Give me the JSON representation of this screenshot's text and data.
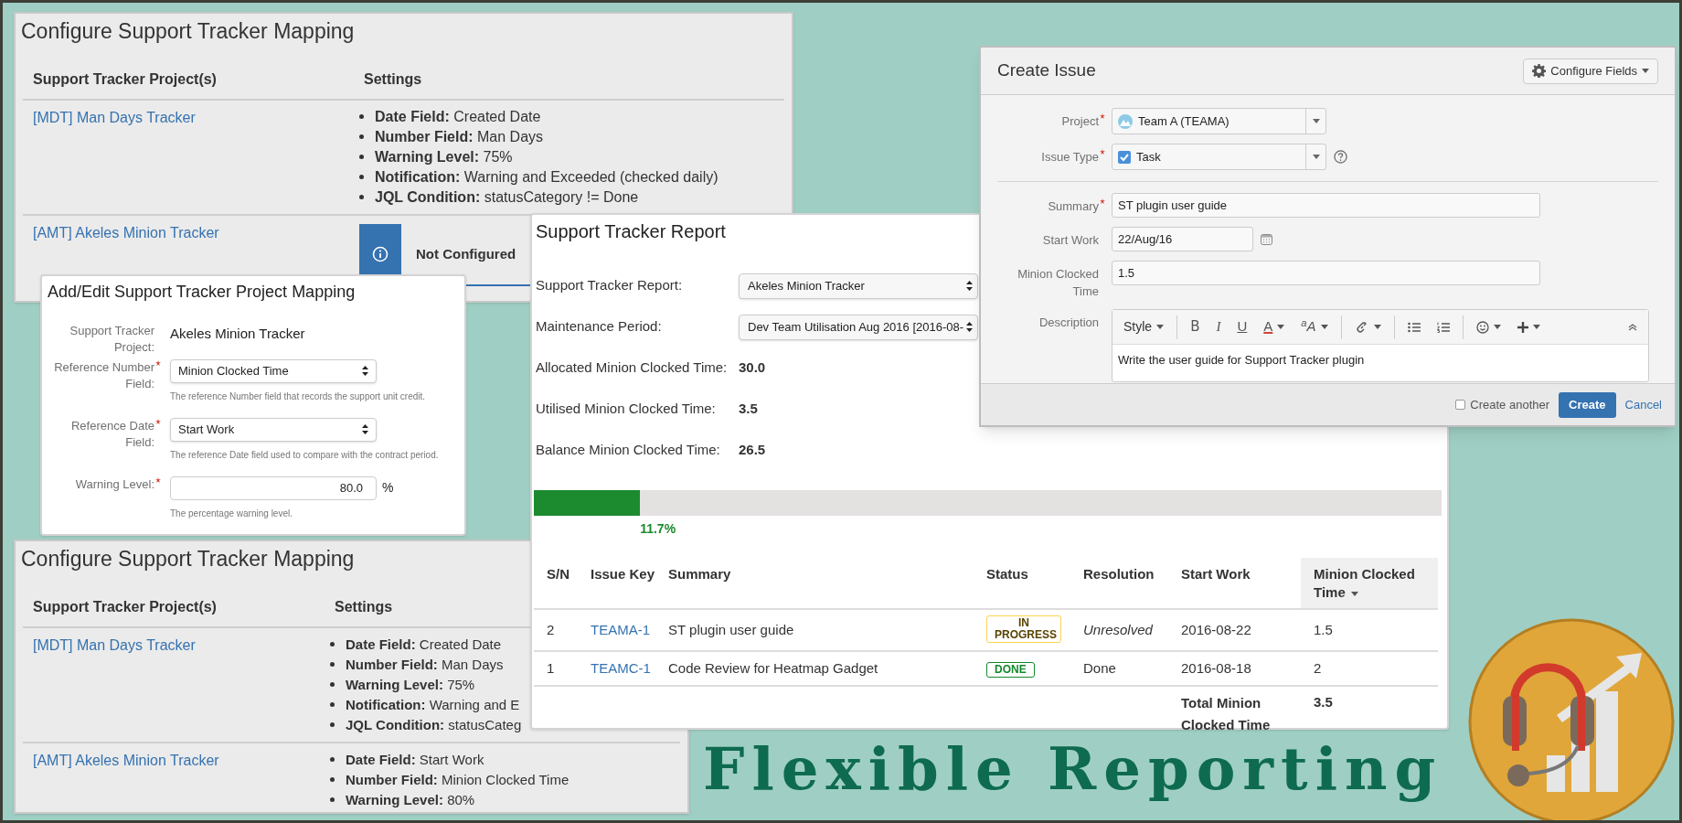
{
  "mapping_top": {
    "title": "Configure Support Tracker Mapping",
    "columns": [
      "Support Tracker Project(s)",
      "Settings"
    ],
    "rows": [
      {
        "project": "[MDT] Man Days Tracker",
        "settings": [
          {
            "label": "Date Field:",
            "value": "Created Date"
          },
          {
            "label": "Number Field:",
            "value": "Man Days"
          },
          {
            "label": "Warning Level:",
            "value": "75%"
          },
          {
            "label": "Notification:",
            "value": "Warning and Exceeded (checked daily)"
          },
          {
            "label": "JQL Condition:",
            "value": "statusCategory != Done"
          }
        ]
      },
      {
        "project": "[AMT] Akeles Minion Tracker",
        "notice": "Not Configured"
      }
    ]
  },
  "create_issue": {
    "title": "Create Issue",
    "configure_button": "Configure Fields",
    "fields": [
      {
        "kind": "project",
        "label": "Project",
        "required": true,
        "value": "Team A (TEAMA)"
      },
      {
        "kind": "issue-type",
        "label": "Issue Type",
        "required": true,
        "value": "Task"
      },
      {
        "kind": "text",
        "label": "Summary",
        "required": true,
        "value": "ST plugin user guide"
      },
      {
        "kind": "date",
        "label": "Start Work",
        "required": false,
        "value": "22/Aug/16"
      },
      {
        "kind": "text",
        "label": "Minion Clocked Time",
        "required": false,
        "value": "1.5"
      },
      {
        "kind": "editor",
        "label": "Description",
        "required": false,
        "value": "Write the user guide for Support Tracker plugin"
      }
    ],
    "toolbar": [
      {
        "kind": "style",
        "label": "Style"
      },
      {
        "kind": "separator"
      },
      {
        "kind": "bold",
        "label": "B"
      },
      {
        "kind": "italic",
        "label": "I"
      },
      {
        "kind": "underline",
        "label": "U"
      },
      {
        "kind": "color",
        "label": "A"
      },
      {
        "kind": "size",
        "label": "$^{a}$A"
      },
      {
        "kind": "separator"
      },
      {
        "kind": "link"
      },
      {
        "kind": "separator"
      },
      {
        "kind": "bullet-list"
      },
      {
        "kind": "number-list"
      },
      {
        "kind": "separator"
      },
      {
        "kind": "emoticon"
      },
      {
        "kind": "insert"
      },
      {
        "kind": "collapse"
      }
    ],
    "create_another": {
      "label": "Create another",
      "checked": false
    },
    "create_button": "Create",
    "cancel_link": "Cancel"
  },
  "mapping_dialog": {
    "title": "Add/Edit Support Tracker Project Mapping",
    "fields": [
      {
        "kind": "text",
        "label": "Support Tracker Project:",
        "required": false,
        "value": "Akeles Minion Tracker"
      },
      {
        "kind": "select",
        "label": "Reference Number Field:",
        "required": true,
        "value": "Minion Clocked Time",
        "help": "The reference Number field that records the support unit credit."
      },
      {
        "kind": "select",
        "label": "Reference Date Field:",
        "required": true,
        "value": "Start Work",
        "help": "The reference Date field used to compare with the contract period."
      },
      {
        "kind": "number",
        "label": "Warning Level:",
        "required": true,
        "value": "80.0",
        "unit": "%",
        "help": "The percentage warning level."
      }
    ]
  },
  "report": {
    "title": "Support Tracker Report",
    "filters": [
      {
        "label": "Support Tracker Report:",
        "value": "Akeles Minion Tracker"
      },
      {
        "label": "Maintenance Period:",
        "value": "Dev Team Utilisation Aug 2016 [2016-08-"
      }
    ],
    "stats": [
      {
        "label": "Allocated Minion Clocked Time:",
        "value": "30.0"
      },
      {
        "label": "Utilised Minion Clocked Time:",
        "value": "3.5"
      },
      {
        "label": "Balance Minion Clocked Time:",
        "value": "26.5"
      }
    ],
    "progress": {
      "level": 0.117,
      "reading": "11.7%"
    },
    "table": {
      "columns": [
        {
          "label": "S/N",
          "sorted": false
        },
        {
          "label": "Issue Key",
          "sorted": false
        },
        {
          "label": "Summary",
          "sorted": false
        },
        {
          "label": "Status",
          "sorted": false
        },
        {
          "label": "Resolution",
          "sorted": false
        },
        {
          "label": "Start Work",
          "sorted": false
        },
        {
          "label": "Minion Clocked Time",
          "sorted": true
        }
      ],
      "rows": [
        {
          "sn": "2",
          "key": "TEAMA-1",
          "summary": "ST plugin user guide",
          "status": {
            "text": "IN PROGRESS",
            "kind": "in-progress"
          },
          "resolution": "Unresolved",
          "resolved": false,
          "start": "2016-08-22",
          "time": "1.5"
        },
        {
          "sn": "1",
          "key": "TEAMC-1",
          "summary": "Code Review for Heatmap Gadget",
          "status": {
            "text": "DONE",
            "kind": "done"
          },
          "resolution": "Done",
          "resolved": true,
          "start": "2016-08-18",
          "time": "2"
        }
      ],
      "total": {
        "label": "Total Minion Clocked Time",
        "value": "3.5"
      }
    }
  },
  "mapping_bottom": {
    "title": "Configure Support Tracker Mapping",
    "columns": [
      "Support Tracker Project(s)",
      "Settings"
    ],
    "rows": [
      {
        "project": "[MDT] Man Days Tracker",
        "settings": [
          {
            "label": "Date Field:",
            "value": "Created Date"
          },
          {
            "label": "Number Field:",
            "value": "Man Days"
          },
          {
            "label": "Warning Level:",
            "value": "75%"
          },
          {
            "label": "Notification:",
            "value": "Warning and E"
          },
          {
            "label": "JQL Condition:",
            "value": "statusCateg"
          }
        ]
      },
      {
        "project": "[AMT] Akeles Minion Tracker",
        "settings": [
          {
            "label": "Date Field:",
            "value": "Start Work"
          },
          {
            "label": "Number Field:",
            "value": "Minion Clocked Time"
          },
          {
            "label": "Warning Level:",
            "value": "80%"
          }
        ]
      }
    ]
  },
  "banner": {
    "text": "Flexible Reporting"
  }
}
